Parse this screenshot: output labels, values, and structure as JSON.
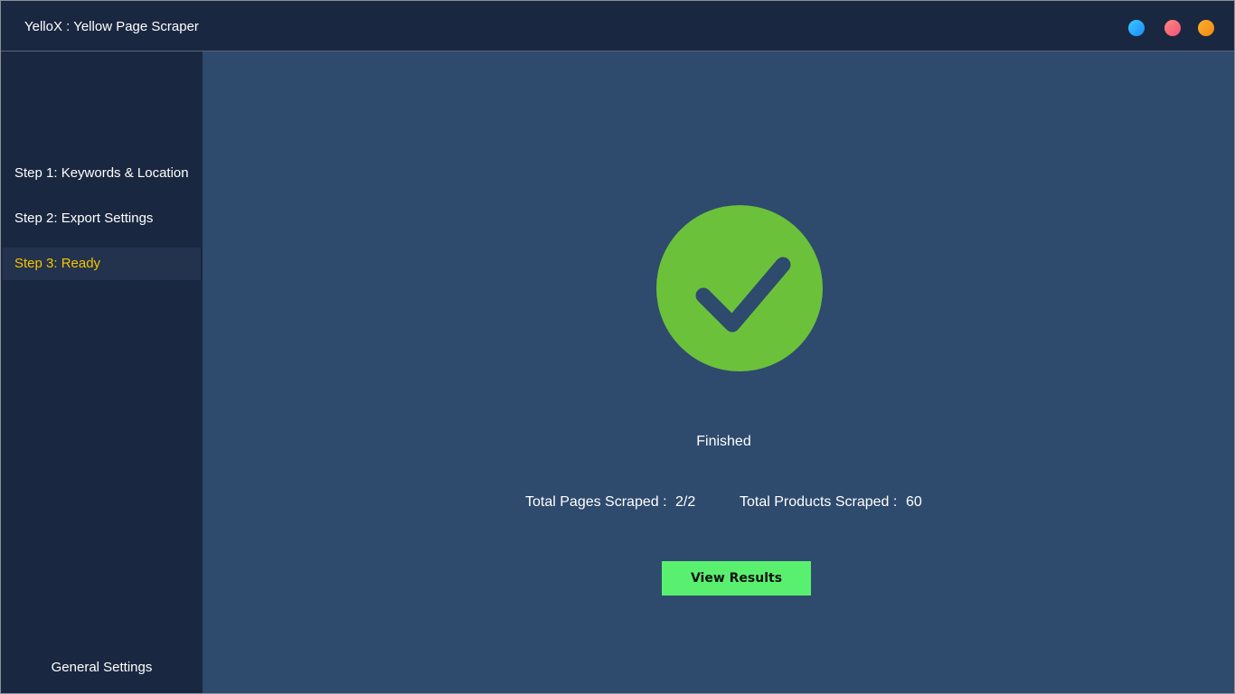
{
  "window": {
    "title": "YelloX : Yellow Page Scraper",
    "controls": [
      {
        "name": "blue-window-button",
        "color": "#1a8cff"
      },
      {
        "name": "pink-window-button",
        "color": "#f0507a"
      },
      {
        "name": "orange-window-button",
        "color": "#f08a10"
      }
    ]
  },
  "sidebar": {
    "items": [
      {
        "label": "Step 1: Keywords & Location",
        "active": false
      },
      {
        "label": "Step 2: Export Settings",
        "active": false
      },
      {
        "label": "Step 3: Ready",
        "active": true
      }
    ],
    "footer_label": "General Settings",
    "active_color": "#f5c400"
  },
  "main": {
    "icon": "check-circle-icon",
    "icon_color": "#6cc13b",
    "status": "Finished",
    "stats": {
      "pages_label": "Total Pages Scraped :",
      "pages_value": "2/2",
      "products_label": "Total Products Scraped :",
      "products_value": "60"
    },
    "button_label": "View Results",
    "button_color": "#5af06f"
  }
}
